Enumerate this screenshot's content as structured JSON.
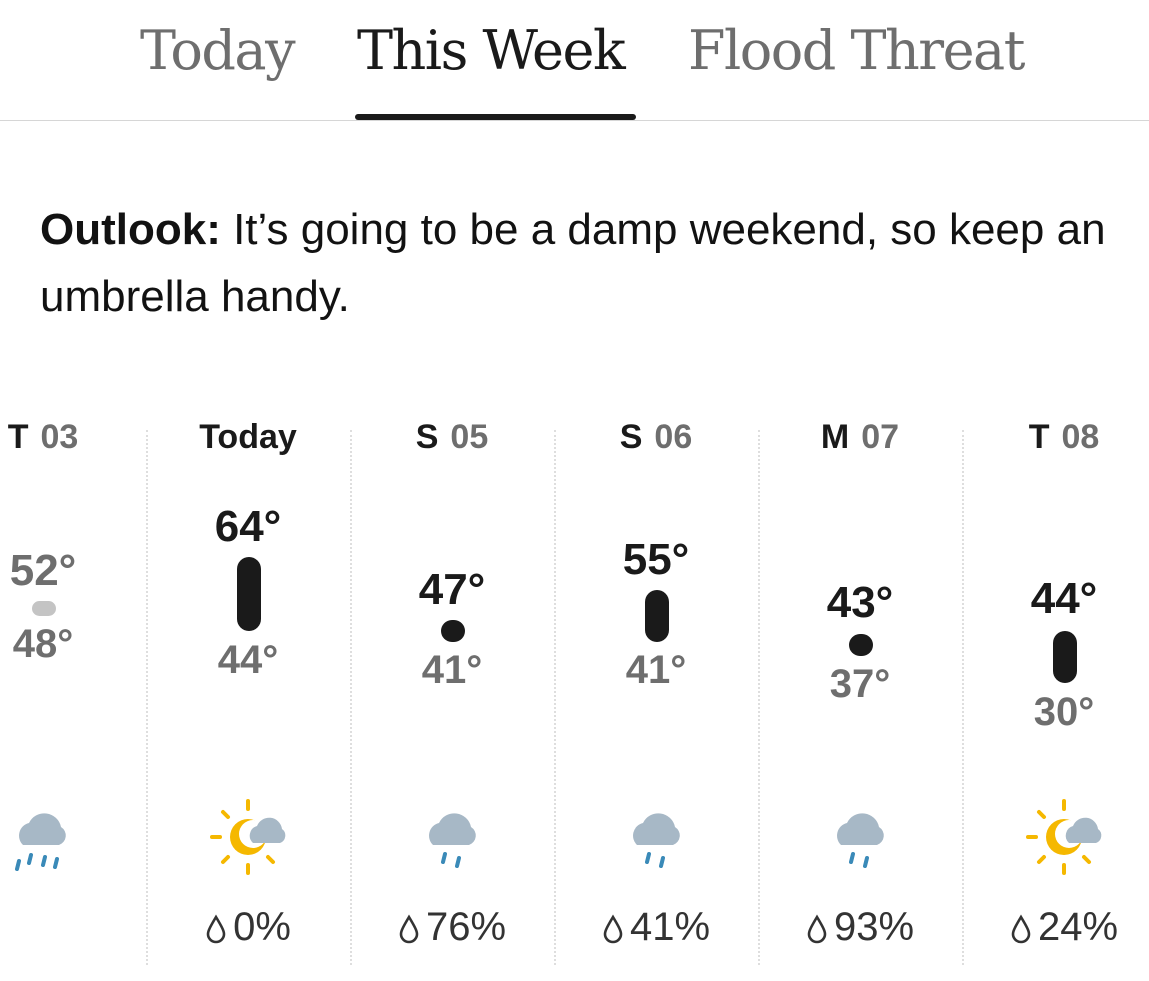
{
  "tabs": [
    {
      "label": "Today",
      "active": false
    },
    {
      "label": "This Week",
      "active": true
    },
    {
      "label": "Flood Threat",
      "active": false
    }
  ],
  "outlook": {
    "label": "Outlook:",
    "text": " It’s going to be a damp weekend, so keep an umbrella handy."
  },
  "days": [
    {
      "day": "T",
      "num": "03",
      "high": "52°",
      "low": "48°",
      "icon": "rain-cloud-icon",
      "precip": ""
    },
    {
      "day": "Today",
      "num": "",
      "high": "64°",
      "low": "44°",
      "icon": "partly-cloudy-sun-icon",
      "precip": "0%"
    },
    {
      "day": "S",
      "num": "05",
      "high": "47°",
      "low": "41°",
      "icon": "rain-cloud-icon",
      "precip": "76%"
    },
    {
      "day": "S",
      "num": "06",
      "high": "55°",
      "low": "41°",
      "icon": "rain-cloud-icon",
      "precip": "41%"
    },
    {
      "day": "M",
      "num": "07",
      "high": "43°",
      "low": "37°",
      "icon": "rain-cloud-icon",
      "precip": "93%"
    },
    {
      "day": "T",
      "num": "08",
      "high": "44°",
      "low": "30°",
      "icon": "partly-cloudy-sun-icon",
      "precip": "24%"
    }
  ],
  "colors": {
    "text": "#1a1a1a",
    "muted": "#6e6e6e",
    "past_bar": "#c4c4c4",
    "cloud": "#a7b8c6",
    "rain": "#3a8ab8",
    "sun": "#f5b800"
  }
}
